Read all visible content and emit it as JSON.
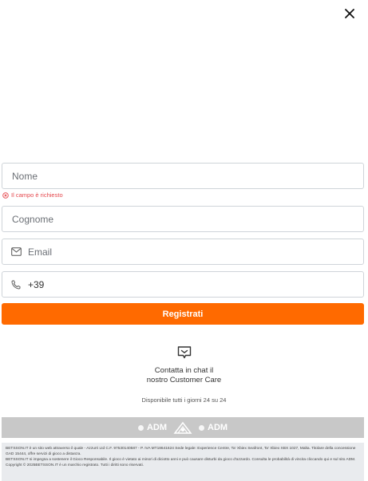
{
  "close": {
    "icon": "close-icon"
  },
  "form": {
    "nome_placeholder": "Nome",
    "nome_error": "Il campo è richiesto",
    "cognome_placeholder": "Cognome",
    "email_placeholder": "Email",
    "phone_prefix": "+39",
    "submit_label": "Registrati"
  },
  "support": {
    "chat_line1": "Contatta in chat il",
    "chat_line2": "nostro Customer Care",
    "availability": "Disponibile tutti i giorni 24 su 24"
  },
  "badges": {
    "adm_left": "ADM",
    "adm_right": "ADM"
  },
  "legal": {
    "line1": "BETSSON.IT è un sito web attraverso il quale - Azzurri Ltd C.F. 97530140587 - P. IVA MT18641624 Sede legale: Experience Centre, Ta' Xbiex Seafront, Ta' Xbiex XBX 1027, Malta. Titolare della concessione GAD 15444, offre servizi di gioco a distanza.",
    "line2": "BETSSON.IT si impegna a sostenere il Gioco Responsabile. Il gioco è vietato ai minori di diciotto anni e può causare disturbi da gioco d'azzardo. Consulta le probabilità di vincita cliccando qui e sul sito ADM.",
    "line3": "Copyright © 2025BETSSON.IT è un marchio registrato. Tutti i diritti sono riservati."
  },
  "colors": {
    "accent": "#ff6a00",
    "error": "#e5484d",
    "border": "#cfd4d9"
  }
}
